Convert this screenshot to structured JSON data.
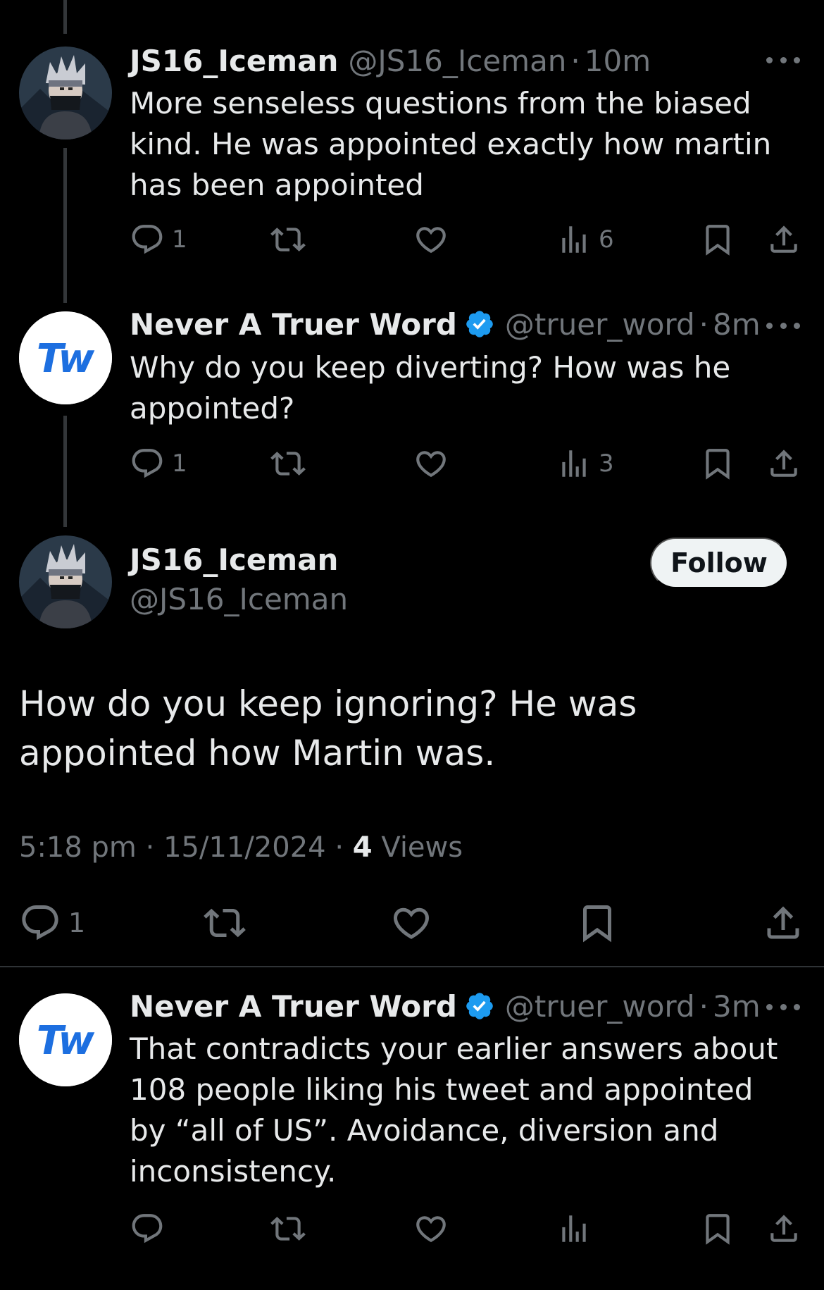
{
  "tweets": [
    {
      "display_name": "JS16_Iceman",
      "verified": false,
      "handle": "@JS16_Iceman",
      "separator": "·",
      "time": "10m",
      "text": "More senseless questions from the biased kind. He was appointed exactly how martin has been appointed",
      "reply_count": "1",
      "retweet_count": "",
      "like_count": "",
      "views_count": "6"
    },
    {
      "display_name": "Never A Truer Word",
      "verified": true,
      "handle": "@truer_word",
      "separator": "·",
      "time": "8m",
      "text": "Why do you keep diverting? How was he appointed?",
      "reply_count": "1",
      "retweet_count": "",
      "like_count": "",
      "views_count": "3"
    },
    {
      "display_name": "Never A Truer Word",
      "verified": true,
      "handle": "@truer_word",
      "separator": "·",
      "time": "3m",
      "text": "That contradicts your earlier answers about 108 people liking his tweet and appointed by “all of US”. Avoidance, diversion and inconsistency.",
      "reply_count": "",
      "retweet_count": "",
      "like_count": "",
      "views_count": ""
    }
  ],
  "focused_tweet": {
    "display_name": "JS16_Iceman",
    "handle": "@JS16_Iceman",
    "follow_label": "Follow",
    "text": "How do you keep ignoring? He was appointed how Martin was.",
    "time": "5:18 pm",
    "date": "15/11/2024",
    "separator": "·",
    "views_count": "4",
    "views_label": "Views",
    "reply_count": "1"
  },
  "avatar_logo_text": "Tw",
  "icons": {
    "reply": "reply-icon",
    "retweet": "retweet-icon",
    "like": "heart-icon",
    "views": "views-chart-icon",
    "bookmark": "bookmark-icon",
    "share": "share-icon",
    "more": "more-dots-icon",
    "verified": "verified-badge-icon"
  },
  "colors": {
    "background": "#000000",
    "primary_text": "#e7e9ea",
    "secondary_text": "#71767b",
    "verified_blue": "#1d9bf0",
    "follow_button_bg": "#eff3f4",
    "follow_button_text": "#0f1419",
    "logo_blue": "#1d6fe0"
  }
}
